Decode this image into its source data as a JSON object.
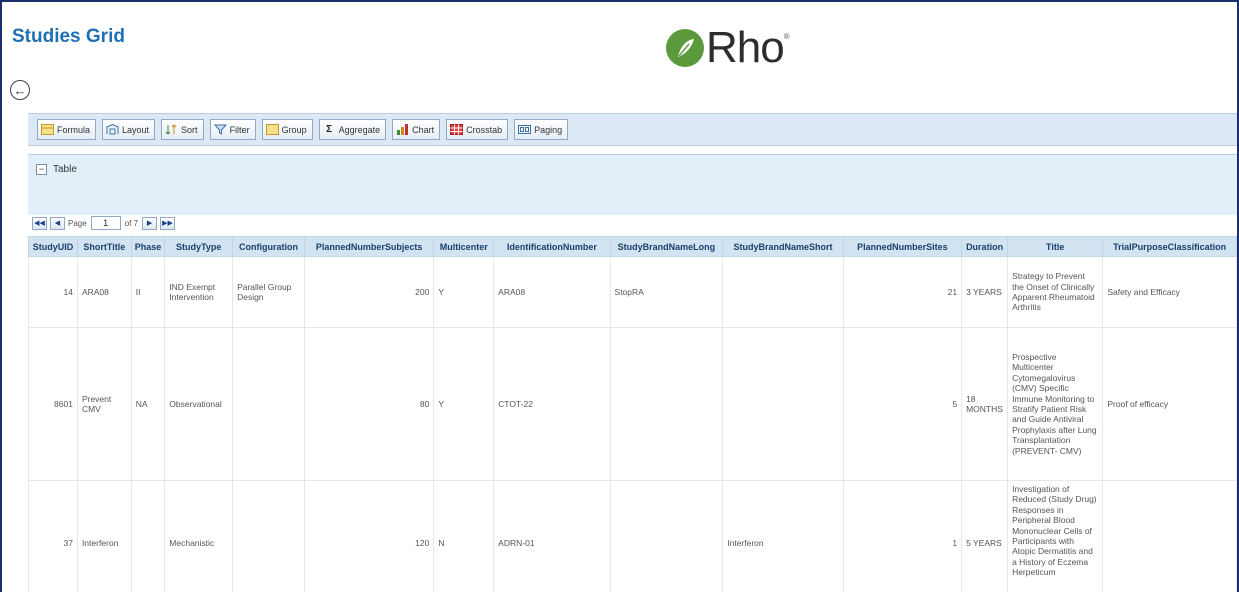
{
  "page": {
    "title": "Studies Grid",
    "logo_text": "Rho",
    "logo_reg": "®"
  },
  "toolbar": {
    "buttons": [
      {
        "label": "Formula",
        "icon": "formula-icon"
      },
      {
        "label": "Layout",
        "icon": "layout-icon"
      },
      {
        "label": "Sort",
        "icon": "sort-icon"
      },
      {
        "label": "Filter",
        "icon": "filter-icon"
      },
      {
        "label": "Group",
        "icon": "group-icon"
      },
      {
        "label": "Aggregate",
        "icon": "sigma-icon"
      },
      {
        "label": "Chart",
        "icon": "chart-icon"
      },
      {
        "label": "Crosstab",
        "icon": "crosstab-icon"
      },
      {
        "label": "Paging",
        "icon": "paging-icon"
      }
    ]
  },
  "panel": {
    "label": "Table",
    "collapse_symbol": "−"
  },
  "pager": {
    "page_label": "Page",
    "current_page": "1",
    "of_label": "of 7"
  },
  "grid": {
    "columns": [
      "StudyUID",
      "ShortTitle",
      "Phase",
      "StudyType",
      "Configuration",
      "PlannedNumberSubjects",
      "Multicenter",
      "IdentificationNumber",
      "StudyBrandNameLong",
      "StudyBrandNameShort",
      "PlannedNumberSites",
      "Duration",
      "Title",
      "TrialPurposeClassification"
    ],
    "rows": [
      {
        "StudyUID": "14",
        "ShortTitle": "ARA08",
        "Phase": "II",
        "StudyType": "IND Exempt Intervention",
        "Configuration": "Parallel Group Design",
        "PlannedNumberSubjects": "200",
        "Multicenter": "Y",
        "IdentificationNumber": "ARA08",
        "StudyBrandNameLong": "StopRA",
        "StudyBrandNameShort": "",
        "PlannedNumberSites": "21",
        "Duration": "3 YEARS",
        "Title": "Strategy to Prevent the Onset of Clinically Apparent Rheumatoid Arthritis",
        "TrialPurposeClassification": "Safety and Efficacy"
      },
      {
        "StudyUID": "8601",
        "ShortTitle": "Prevent CMV",
        "Phase": "NA",
        "StudyType": "Observational",
        "Configuration": "",
        "PlannedNumberSubjects": "80",
        "Multicenter": "Y",
        "IdentificationNumber": "CTOT-22",
        "StudyBrandNameLong": "",
        "StudyBrandNameShort": "",
        "PlannedNumberSites": "5",
        "Duration": "18 MONTHS",
        "Title": "Prospective Multicenter Cytomegalovirus (CMV) Specific Immune Monitoring to Stratify Patient Risk and Guide Antiviral Prophylaxis after Lung Transplantation (PREVENT- CMV)",
        "TrialPurposeClassification": "Proof of efficacy"
      },
      {
        "StudyUID": "37",
        "ShortTitle": "Interferon",
        "Phase": "",
        "StudyType": "Mechanistic",
        "Configuration": "",
        "PlannedNumberSubjects": "120",
        "Multicenter": "N",
        "IdentificationNumber": "ADRN-01",
        "StudyBrandNameLong": "",
        "StudyBrandNameShort": "Interferon",
        "PlannedNumberSites": "1",
        "Duration": "5 YEARS",
        "Title": "Investigation of Reduced (Study Drug) Responses in Peripheral Blood Mononuclear Cells of Participants with Atopic Dermatitis and a History of Eczema Herpeticum",
        "TrialPurposeClassification": ""
      }
    ]
  },
  "colors": {
    "title_blue": "#1f6fb5",
    "toolbar_bg": "#dce9f5",
    "header_bg": "#d2e3f2",
    "logo_green": "#5b9a3c",
    "frame": "#1c2f6b"
  }
}
